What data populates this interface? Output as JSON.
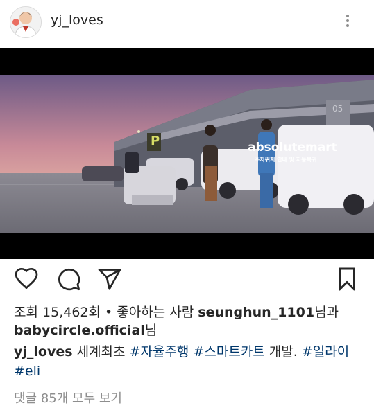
{
  "post": {
    "username": "yj_loves",
    "media": {
      "brand_text": "absolutemart",
      "brand_subtitle": "주차위치 안내 및 자동복귀",
      "sign_letter": "P",
      "building_number": "05"
    },
    "stats": {
      "views_label": "조회",
      "views_count": "15,462회",
      "separator": " • ",
      "liked_by_prefix": "좋아하는 사람",
      "liker1": "seunghun_1101",
      "connector": "님과",
      "liker2": "babycircle.official",
      "suffix": "님"
    },
    "caption": {
      "username": "yj_loves",
      "text": "세계최초",
      "tag1": "#자율주행",
      "tag2": "#스마트카트",
      "text2": "개발.",
      "tag3": "#일라이",
      "tag4": "#eli"
    },
    "comments_link": "댓글 85개 모두 보기"
  },
  "colors": {
    "text": "#262626",
    "muted": "#8e8e8e",
    "hashtag": "#00376b"
  },
  "icons": [
    "heart-icon",
    "comment-icon",
    "share-icon",
    "bookmark-icon",
    "more-options-icon"
  ]
}
